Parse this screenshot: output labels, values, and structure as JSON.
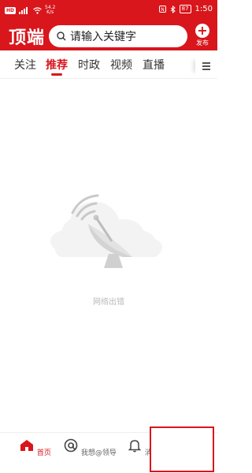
{
  "status_bar": {
    "carrier_badge": "HD",
    "net_speed": "54.2",
    "net_unit": "K/s",
    "battery": "87",
    "time": "1:50"
  },
  "header": {
    "logo": "顶端",
    "search_placeholder": "请输入关键字",
    "publish_label": "发布"
  },
  "tabs": [
    {
      "label": "关注"
    },
    {
      "label": "推荐",
      "active": true
    },
    {
      "label": "时政"
    },
    {
      "label": "视频"
    },
    {
      "label": "直播"
    }
  ],
  "empty_state": {
    "message": "网络出错"
  },
  "bottom_nav": [
    {
      "label": "首页",
      "icon": "home-icon",
      "active": true
    },
    {
      "label": "我想@领导",
      "icon": "at-icon"
    },
    {
      "label": "消息",
      "icon": "bell-icon"
    }
  ],
  "colors": {
    "brand": "#d8161c",
    "muted": "#b9b9b9"
  }
}
